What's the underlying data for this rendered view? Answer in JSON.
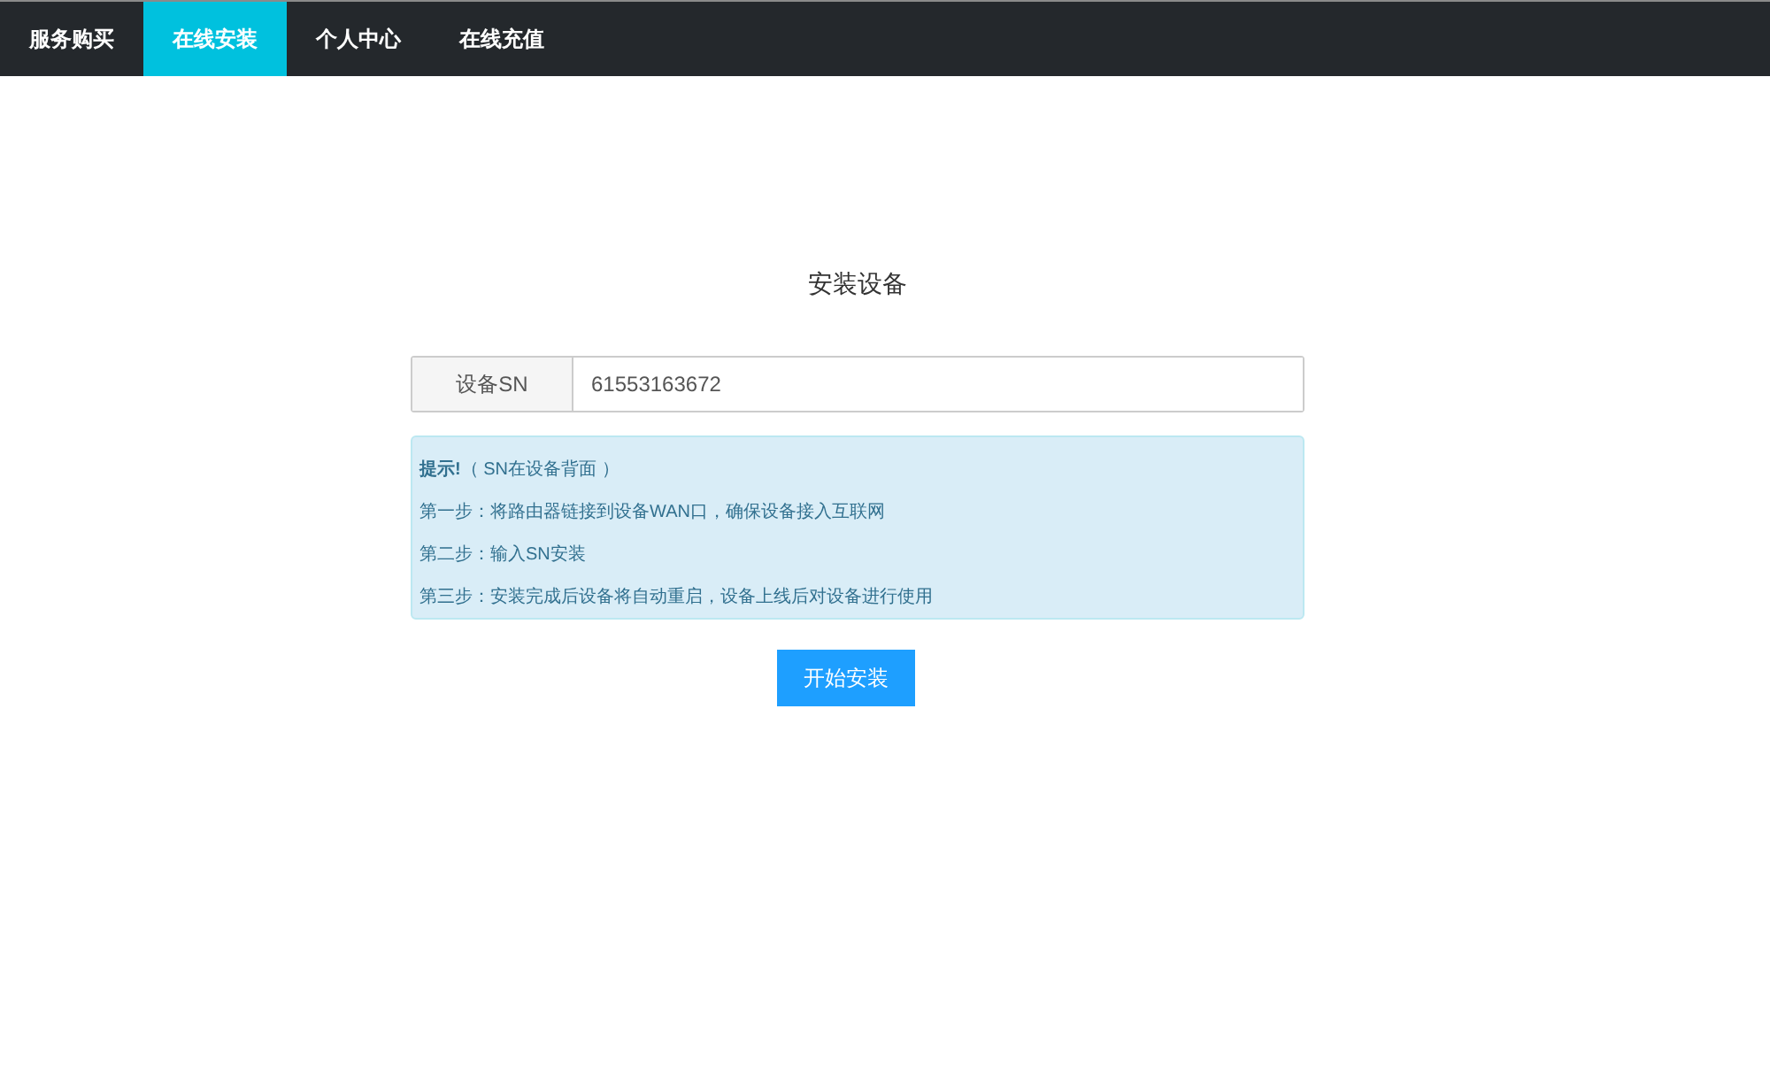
{
  "nav": {
    "tabs": [
      {
        "label": "服务购买",
        "selected": false
      },
      {
        "label": "在线安装",
        "selected": true
      },
      {
        "label": "个人中心",
        "selected": false
      },
      {
        "label": "在线充值",
        "selected": false
      }
    ]
  },
  "form": {
    "title": "安装设备",
    "sn_field": {
      "label": "设备SN",
      "value": "61553163672"
    },
    "notice": {
      "heading": "**提示!**（ SN在设备背面 ）",
      "steps": [
        "第一步：将路由器链接到设备WAN口，确保设备接入互联网",
        "第二步：输入SN安装",
        "第三步：安装完成后设备将自动重启，设备上线后对设备进行使用"
      ]
    },
    "submit_button": "开始安装"
  }
}
